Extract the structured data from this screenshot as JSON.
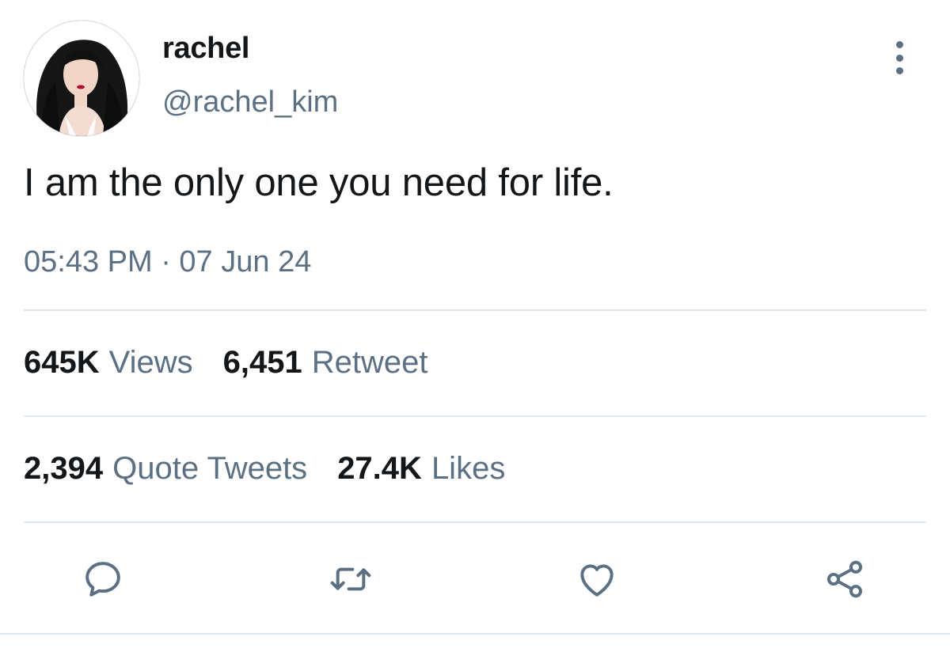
{
  "author": {
    "display_name": "rachel",
    "handle": "@rachel_kim",
    "avatar_icon": "profile-photo"
  },
  "tweet": {
    "text": "I am the only one you need for life.",
    "timestamp": "05:43 PM · 07 Jun 24"
  },
  "stats": {
    "views": {
      "count": "645K",
      "label": "Views"
    },
    "retweets": {
      "count": "6,451",
      "label": "Retweet"
    },
    "quote_tweets": {
      "count": "2,394",
      "label": "Quote Tweets"
    },
    "likes": {
      "count": "27.4K",
      "label": "Likes"
    }
  },
  "actions": [
    "reply-icon",
    "retweet-icon",
    "like-icon",
    "share-icon"
  ],
  "colors": {
    "text_primary": "#14171a",
    "text_secondary": "#5b7083",
    "divider": "#e1e8ed",
    "icon": "#5b7083"
  }
}
